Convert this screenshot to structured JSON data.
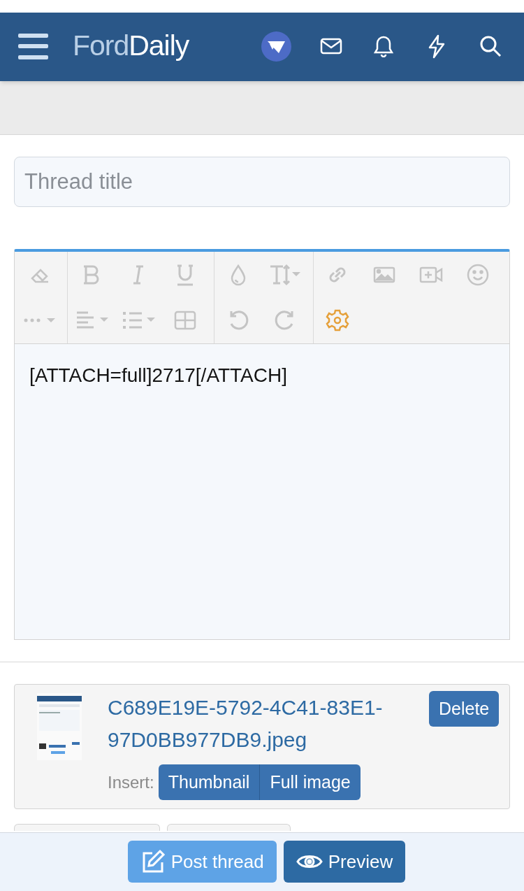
{
  "header": {
    "logo": {
      "light": "Ford",
      "bold": "Daily"
    }
  },
  "thread_title": {
    "placeholder": "Thread title"
  },
  "editor": {
    "source_mode": true,
    "content": "[ATTACH=full]2717[/ATTACH]"
  },
  "attachment": {
    "kind": "picture",
    "filename": "C689E19E-5792-4C41-83E1-97D0BB977DB9.jpeg",
    "delete": "Delete",
    "insert_label": "Insert:",
    "insert_options": [
      "Thumbnail",
      "Full image"
    ]
  },
  "actions": [
    {
      "label": "Post thread",
      "kind": "primary"
    },
    {
      "label": "Preview",
      "kind": "secondary"
    }
  ]
}
